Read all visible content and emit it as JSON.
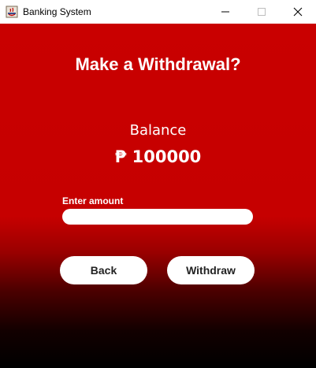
{
  "window": {
    "title": "Banking System"
  },
  "heading": "Make a Withdrawal?",
  "balance": {
    "label": "Balance",
    "value": "₱ 100000"
  },
  "amount": {
    "label": "Enter amount",
    "value": ""
  },
  "buttons": {
    "back": "Back",
    "withdraw": "Withdraw"
  },
  "colors": {
    "accent": "#c90000",
    "bottom": "#000000"
  },
  "icons": {
    "app": "java-coffee-icon",
    "minimize": "minimize-icon",
    "maximize": "maximize-icon",
    "close": "close-icon"
  }
}
